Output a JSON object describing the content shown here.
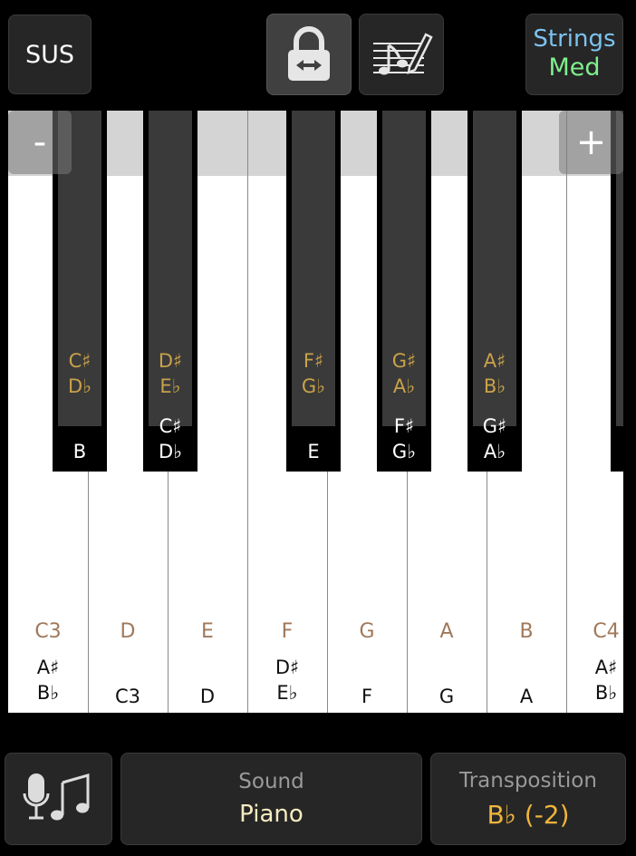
{
  "toolbar": {
    "sus_label": "SUS",
    "instrument_line1": "Strings",
    "instrument_line2": "Med"
  },
  "keyboard": {
    "zoom_out_label": "-",
    "zoom_in_label": "+",
    "black_keys": [
      {
        "top1": "C♯",
        "top2": "D♭",
        "bot1": "",
        "bot2": "B"
      },
      {
        "top1": "D♯",
        "top2": "E♭",
        "bot1": "C♯",
        "bot2": "D♭"
      },
      {
        "top1": "F♯",
        "top2": "G♭",
        "bot1": "",
        "bot2": "E"
      },
      {
        "top1": "G♯",
        "top2": "A♭",
        "bot1": "F♯",
        "bot2": "G♭"
      },
      {
        "top1": "A♯",
        "top2": "B♭",
        "bot1": "G♯",
        "bot2": "A♭"
      }
    ],
    "white_keys": [
      {
        "name": "C3",
        "bot1": "A♯",
        "bot2": "B♭"
      },
      {
        "name": "D",
        "bot1": "",
        "bot2": "C3"
      },
      {
        "name": "E",
        "bot1": "",
        "bot2": "D"
      },
      {
        "name": "F",
        "bot1": "D♯",
        "bot2": "E♭"
      },
      {
        "name": "G",
        "bot1": "",
        "bot2": "F"
      },
      {
        "name": "A",
        "bot1": "",
        "bot2": "G"
      },
      {
        "name": "B",
        "bot1": "",
        "bot2": "A"
      },
      {
        "name": "C4",
        "bot1": "A♯",
        "bot2": "B♭"
      }
    ]
  },
  "bottom": {
    "sound_caption": "Sound",
    "sound_value": "Piano",
    "transposition_caption": "Transposition",
    "transposition_value": "B♭ (-2)"
  },
  "icons": {
    "lock": "lock-swap-icon",
    "notes": "music-pencil-icon",
    "mic": "mic-music-icon"
  },
  "colors": {
    "sharp_label": "#c9a24a",
    "white_key_name": "#a0785a",
    "strings": "#7cc3f0",
    "med": "#7ef08e",
    "transposition": "#f0b43c"
  }
}
